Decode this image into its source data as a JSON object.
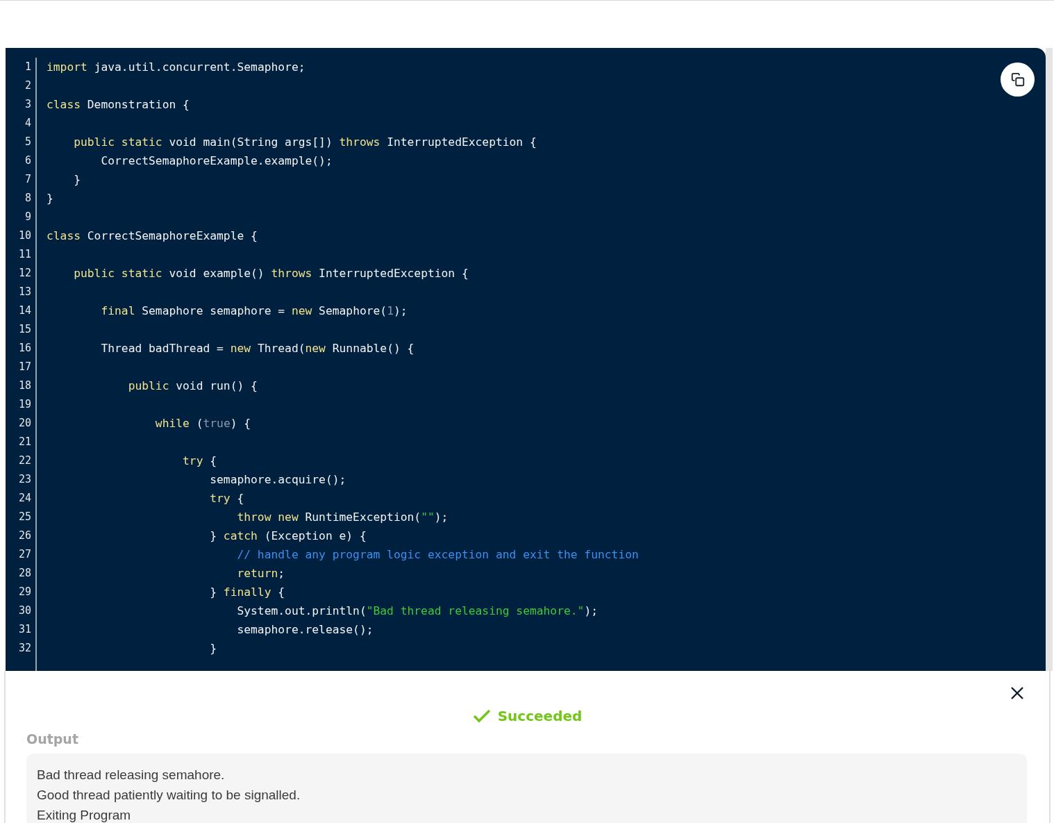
{
  "code": {
    "lines": [
      {
        "number": "1",
        "tokens": [
          {
            "kind": "keyword",
            "text": "import"
          },
          {
            "kind": "plain",
            "text": " java.util.concurrent.Semaphore;"
          }
        ]
      },
      {
        "number": "2"
      },
      {
        "number": "3",
        "tokens": [
          {
            "kind": "keyword",
            "text": "class"
          },
          {
            "kind": "plain",
            "text": " Demonstration {"
          }
        ]
      },
      {
        "number": "4"
      },
      {
        "number": "5",
        "tokens": [
          {
            "kind": "keyword",
            "text": "    public static"
          },
          {
            "kind": "plain",
            "text": " void main(String args[]) "
          },
          {
            "kind": "keyword",
            "text": "throws"
          },
          {
            "kind": "plain",
            "text": " InterruptedException {"
          }
        ]
      },
      {
        "number": "6",
        "tokens": [
          {
            "kind": "plain",
            "text": "        CorrectSemaphoreExample.example();"
          }
        ]
      },
      {
        "number": "7",
        "tokens": [
          {
            "kind": "plain",
            "text": "    }"
          }
        ]
      },
      {
        "number": "8",
        "tokens": [
          {
            "kind": "plain",
            "text": "}"
          }
        ]
      },
      {
        "number": "9"
      },
      {
        "number": "10",
        "tokens": [
          {
            "kind": "keyword",
            "text": "class"
          },
          {
            "kind": "plain",
            "text": " CorrectSemaphoreExample {"
          }
        ]
      },
      {
        "number": "11"
      },
      {
        "number": "12",
        "tokens": [
          {
            "kind": "keyword",
            "text": "    public static"
          },
          {
            "kind": "plain",
            "text": " void example() "
          },
          {
            "kind": "keyword",
            "text": "throws"
          },
          {
            "kind": "plain",
            "text": " InterruptedException {"
          }
        ]
      },
      {
        "number": "13"
      },
      {
        "number": "14",
        "tokens": [
          {
            "kind": "keyword",
            "text": "        final"
          },
          {
            "kind": "plain",
            "text": " Semaphore semaphore = "
          },
          {
            "kind": "keyword",
            "text": "new"
          },
          {
            "kind": "plain",
            "text": " Semaphore("
          },
          {
            "kind": "literal",
            "text": "1"
          },
          {
            "kind": "plain",
            "text": ");"
          }
        ]
      },
      {
        "number": "15"
      },
      {
        "number": "16",
        "tokens": [
          {
            "kind": "plain",
            "text": "        Thread badThread = "
          },
          {
            "kind": "keyword",
            "text": "new"
          },
          {
            "kind": "plain",
            "text": " Thread("
          },
          {
            "kind": "keyword",
            "text": "new"
          },
          {
            "kind": "plain",
            "text": " Runnable() {"
          }
        ]
      },
      {
        "number": "17"
      },
      {
        "number": "18",
        "tokens": [
          {
            "kind": "keyword",
            "text": "            public"
          },
          {
            "kind": "plain",
            "text": " void run() {"
          }
        ]
      },
      {
        "number": "19"
      },
      {
        "number": "20",
        "tokens": [
          {
            "kind": "keyword",
            "text": "                while"
          },
          {
            "kind": "plain",
            "text": " ("
          },
          {
            "kind": "literal",
            "text": "true"
          },
          {
            "kind": "plain",
            "text": ") {"
          }
        ]
      },
      {
        "number": "21"
      },
      {
        "number": "22",
        "tokens": [
          {
            "kind": "keyword",
            "text": "                    try"
          },
          {
            "kind": "plain",
            "text": " {"
          }
        ]
      },
      {
        "number": "23",
        "tokens": [
          {
            "kind": "plain",
            "text": "                        semaphore.acquire();"
          }
        ]
      },
      {
        "number": "24",
        "tokens": [
          {
            "kind": "keyword",
            "text": "                        try"
          },
          {
            "kind": "plain",
            "text": " {"
          }
        ]
      },
      {
        "number": "25",
        "tokens": [
          {
            "kind": "keyword",
            "text": "                            throw new"
          },
          {
            "kind": "plain",
            "text": " RuntimeException("
          },
          {
            "kind": "string",
            "text": "\"\""
          },
          {
            "kind": "plain",
            "text": ");"
          }
        ]
      },
      {
        "number": "26",
        "tokens": [
          {
            "kind": "plain",
            "text": "                        } "
          },
          {
            "kind": "keyword",
            "text": "catch"
          },
          {
            "kind": "plain",
            "text": " (Exception e) {"
          }
        ]
      },
      {
        "number": "27",
        "tokens": [
          {
            "kind": "comment",
            "text": "                            // handle any program logic exception and exit the function"
          }
        ]
      },
      {
        "number": "28",
        "tokens": [
          {
            "kind": "keyword",
            "text": "                            return"
          },
          {
            "kind": "plain",
            "text": ";"
          }
        ]
      },
      {
        "number": "29",
        "tokens": [
          {
            "kind": "plain",
            "text": "                        } "
          },
          {
            "kind": "keyword",
            "text": "finally"
          },
          {
            "kind": "plain",
            "text": " {"
          }
        ]
      },
      {
        "number": "30",
        "tokens": [
          {
            "kind": "plain",
            "text": "                            System.out.println("
          },
          {
            "kind": "string",
            "text": "\"Bad thread releasing semahore.\""
          },
          {
            "kind": "plain",
            "text": ");"
          }
        ]
      },
      {
        "number": "31",
        "tokens": [
          {
            "kind": "plain",
            "text": "                            semaphore.release();"
          }
        ]
      },
      {
        "number": "32",
        "tokens": [
          {
            "kind": "plain",
            "text": "                        }"
          }
        ]
      }
    ]
  },
  "result": {
    "status": "Succeeded",
    "output_label": "Output",
    "output_lines": [
      "Bad thread releasing semahore.",
      "Good thread patiently waiting to be signalled.",
      "Exiting Program"
    ]
  }
}
